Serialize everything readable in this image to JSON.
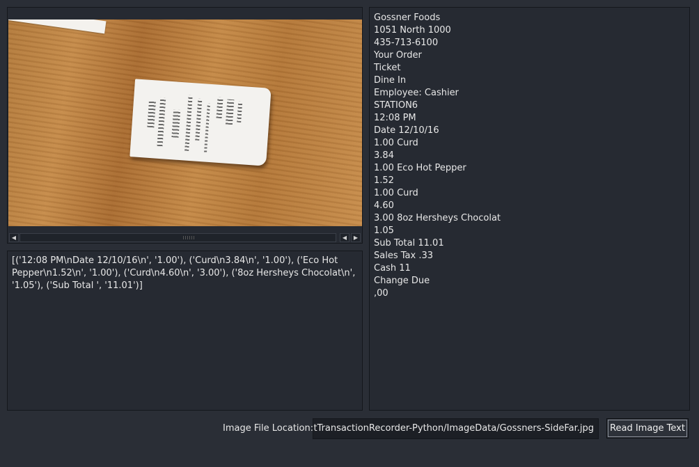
{
  "image_view": {
    "photo_description_icon": "receipt-photo"
  },
  "parsed_output": {
    "text": "[('12:08 PM\\nDate 12/10/16\\n', '1.00'), ('Curd\\n3.84\\n', '1.00'), ('Eco Hot Pepper\\n1.52\\n', '1.00'), ('Curd\\n4.60\\n', '3.00'), ('8oz Hersheys Chocolat\\n', '1.05'), ('Sub Total ', '11.01')]"
  },
  "ocr_text": {
    "lines": [
      "Gossner Foods",
      "1051 North 1000",
      "435-713-6100",
      "Your Order",
      "Ticket",
      "Dine In",
      "Employee: Cashier",
      "STATION6",
      "12:08 PM",
      "Date 12/10/16",
      "1.00 Curd",
      "3.84",
      "1.00 Eco Hot Pepper",
      "1.52",
      "1.00 Curd",
      "4.60",
      "3.00 8oz Hersheys Chocolat",
      "1.05",
      "Sub Total 11.01",
      "Sales Tax .33",
      "Cash 11",
      "Change Due",
      ",00"
    ]
  },
  "controls": {
    "file_label": "Image File Location:",
    "file_path": "eiptTransactionRecorder-Python/ImageData/Gossners-SideFar.jpg",
    "read_button_label": "Read Image Text"
  },
  "colors": {
    "window_bg": "#2a2e36",
    "panel_bg": "#262a32",
    "text": "#e8e8e8"
  }
}
